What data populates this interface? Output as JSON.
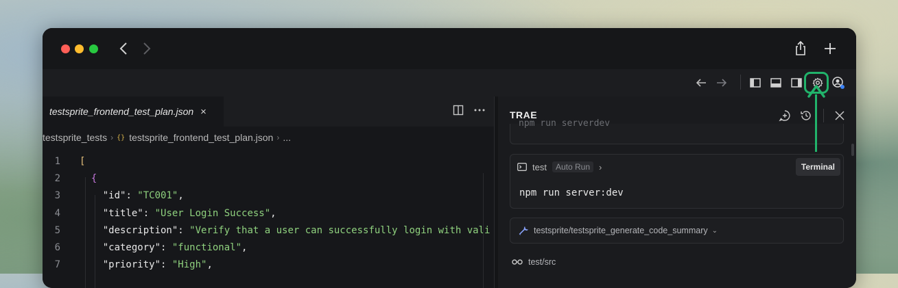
{
  "app": {
    "panel_title": "TRAE"
  },
  "editor": {
    "tab_label": "testsprite_frontend_test_plan.json",
    "tab_close": "×",
    "breadcrumb": {
      "folder": "testsprite_tests",
      "file_icon": "{}",
      "file": "testsprite_frontend_test_plan.json",
      "more": "..."
    },
    "code_lines": [
      {
        "n": "1"
      },
      {
        "n": "2"
      },
      {
        "n": "3",
        "key": "\"id\"",
        "value": "\"TC001\""
      },
      {
        "n": "4",
        "key": "\"title\"",
        "value": "\"User Login Success\""
      },
      {
        "n": "5",
        "key": "\"description\"",
        "value": "\"Verify that a user can successfully login with vali"
      },
      {
        "n": "6",
        "key": "\"category\"",
        "value": "\"functional\""
      },
      {
        "n": "7",
        "key": "\"priority\"",
        "value": "\"High\""
      }
    ]
  },
  "panel": {
    "prev_command_cut": "npm run serverdev",
    "terminal": {
      "name": "test",
      "badge": "Auto Run",
      "button": "Terminal",
      "command": "npm run server:dev"
    },
    "tool_call": "testsprite/testsprite_generate_code_summary",
    "source_path": "test/src"
  },
  "colors": {
    "highlight": "#21b36b",
    "string": "#8fd17e",
    "bracket1": "#e5c07b",
    "bracket2": "#c678dd"
  }
}
